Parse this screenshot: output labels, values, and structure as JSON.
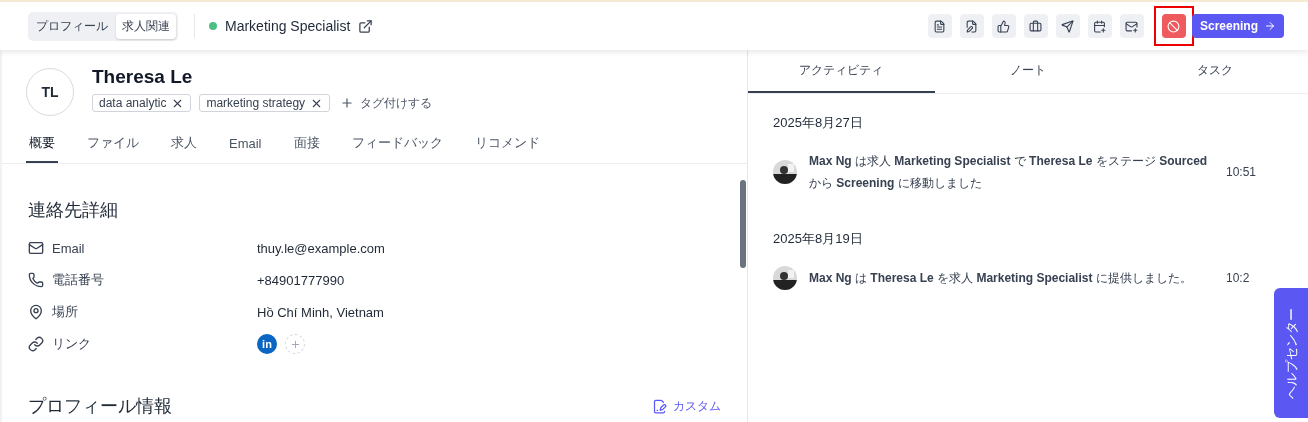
{
  "header": {
    "view_toggle": [
      {
        "label": "プロフィール",
        "selected": false
      },
      {
        "label": "求人関連",
        "selected": true
      }
    ],
    "job_title": "Marketing Specialist",
    "reject_button": {
      "highlighted": true
    },
    "stage_button": {
      "label": "Screening"
    }
  },
  "candidate": {
    "initials": "TL",
    "name": "Theresa Le",
    "tags": [
      "data analytic",
      "marketing strategy"
    ],
    "add_tag": "タグ付けする"
  },
  "profile_tabs": [
    {
      "label": "概要",
      "selected": true
    },
    {
      "label": "ファイル",
      "selected": false
    },
    {
      "label": "求人",
      "selected": false
    },
    {
      "label": "Email",
      "selected": false
    },
    {
      "label": "面接",
      "selected": false
    },
    {
      "label": "フィードバック",
      "selected": false
    },
    {
      "label": "リコメンド",
      "selected": false
    }
  ],
  "contact": {
    "title": "連絡先詳細",
    "rows": [
      {
        "kind": "email",
        "label": "Email",
        "value": "thuy.le@example.com"
      },
      {
        "kind": "phone",
        "label": "電話番号",
        "value": "+84901777990"
      },
      {
        "kind": "location",
        "label": "場所",
        "value": "Hồ Chí Minh, Vietnam"
      },
      {
        "kind": "links",
        "label": "リンク",
        "value": "in"
      }
    ]
  },
  "profile_info": {
    "title": "プロフィール情報",
    "action": "カスタム"
  },
  "activity": {
    "tabs": [
      {
        "label": "アクティビティ",
        "selected": true
      },
      {
        "label": "ノート",
        "selected": false
      },
      {
        "label": "タスク",
        "selected": false
      }
    ],
    "groups": [
      {
        "date": "2025年8月27日",
        "items": [
          {
            "text": "**Max Ng** は求人 **Marketing Specialist** で **Theresa Le** をステージ **Sourced** から **Screening** に移動しました",
            "time": "10:51"
          }
        ]
      },
      {
        "date": "2025年8月19日",
        "items": [
          {
            "text": "**Max Ng** は **Theresa Le** を求人 **Marketing Specialist** に提供しました。",
            "time": "10:2"
          }
        ]
      }
    ]
  },
  "help_tab": {
    "label": "ヘルプセンター"
  }
}
